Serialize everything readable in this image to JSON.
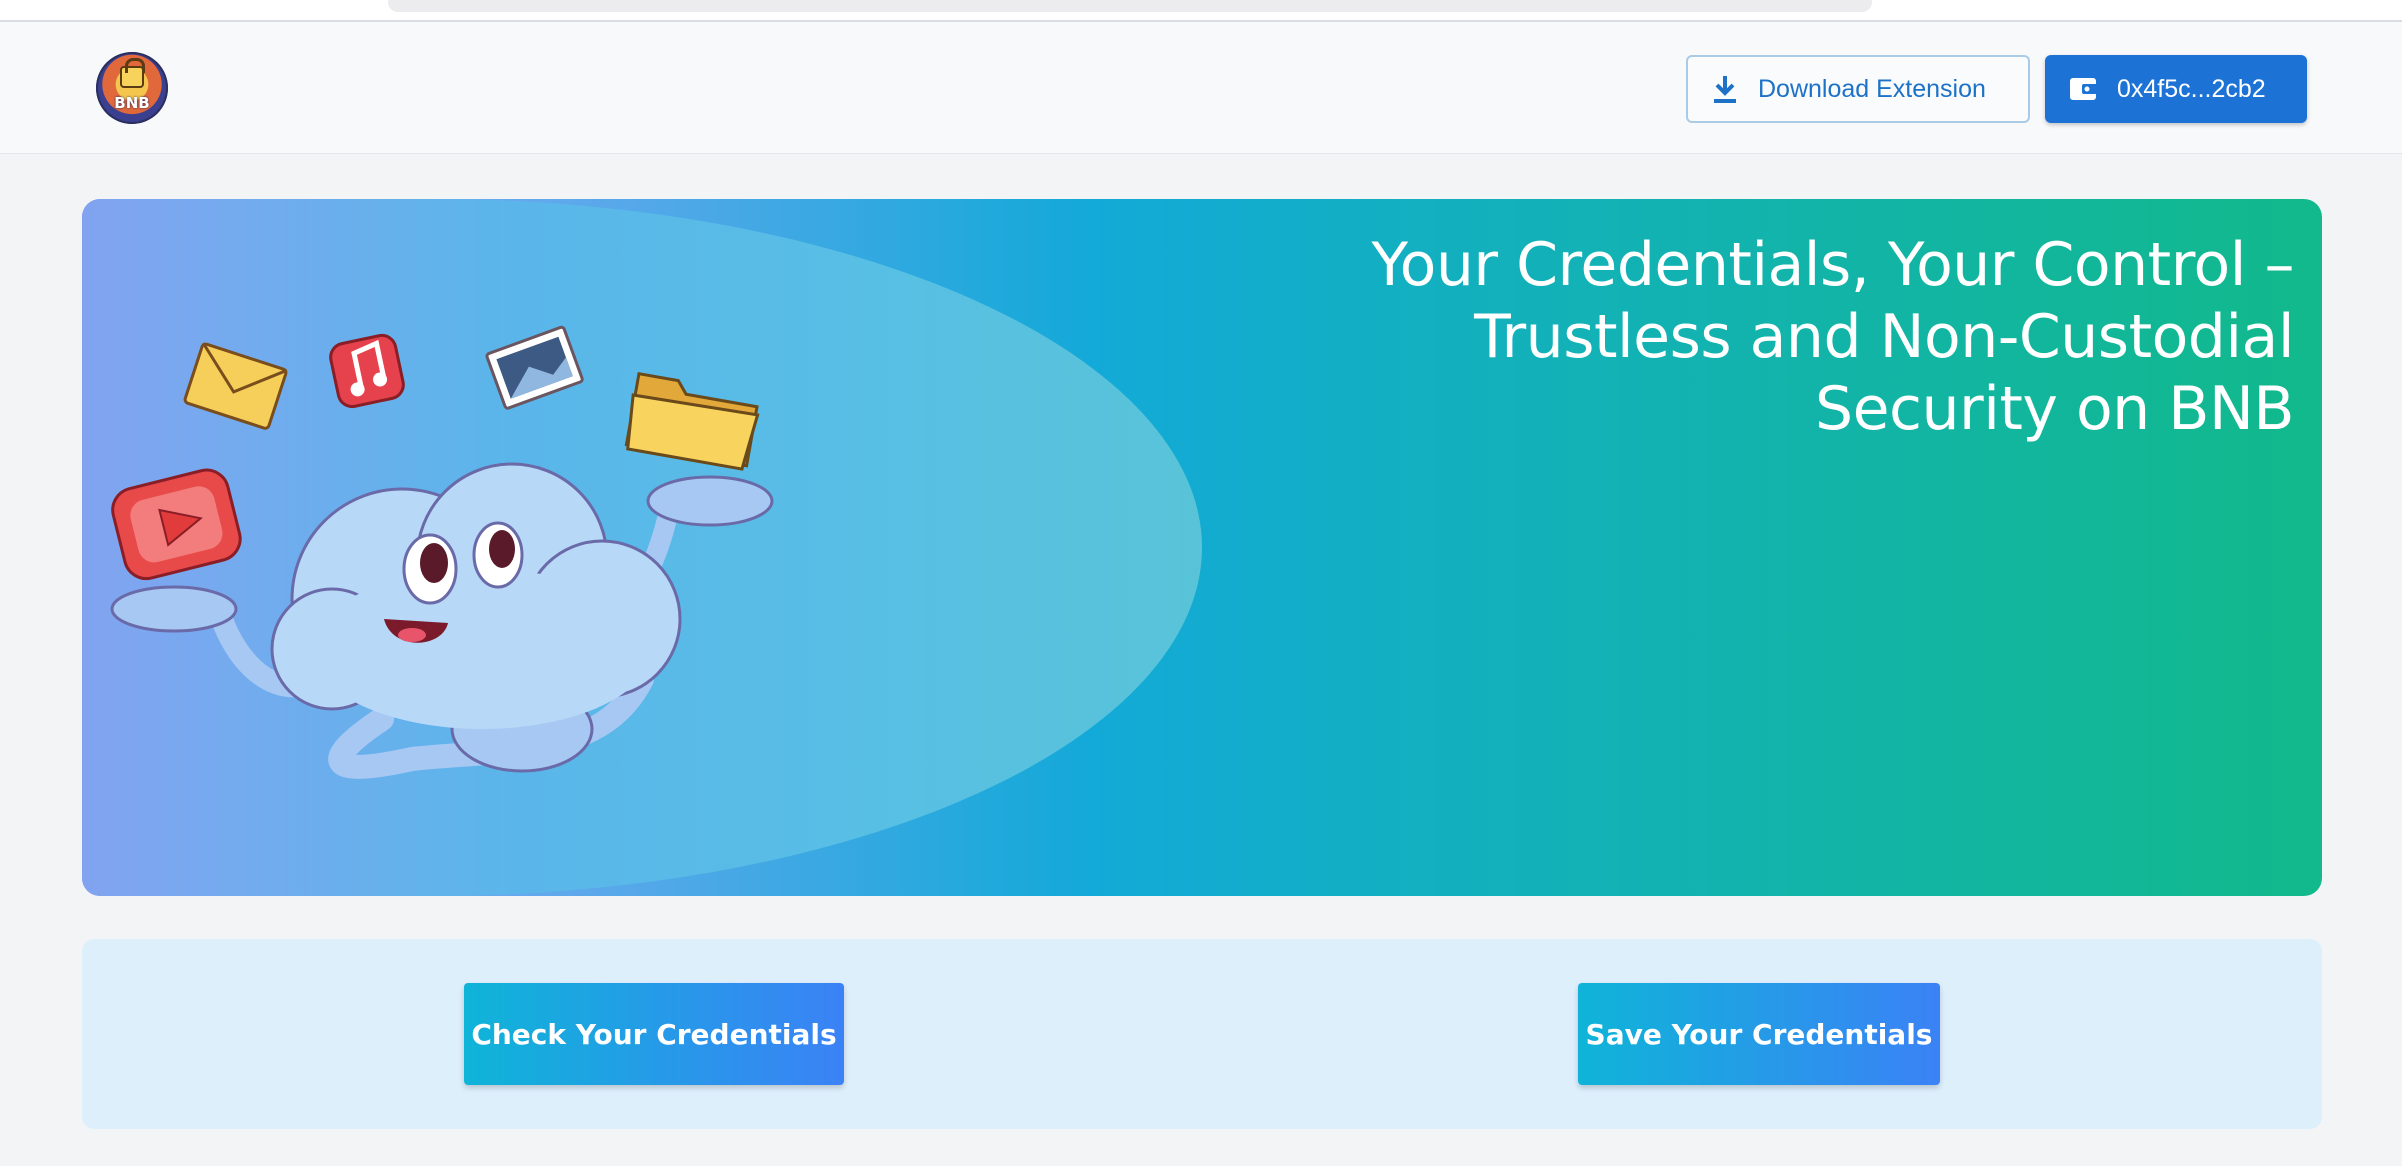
{
  "header": {
    "logo_text": "BNB",
    "download_label": "Download Extension",
    "wallet_label": "0x4f5c...2cb2"
  },
  "hero": {
    "title_line1": "Your Credentials, Your Control –",
    "title_line2": "Trustless and Non-Custodial",
    "title_line3": "Security on BNB"
  },
  "actions": {
    "check_label": "Check Your Credentials",
    "save_label": "Save Your Credentials"
  },
  "icons": {
    "download": "download-icon",
    "wallet": "wallet-icon"
  },
  "colors": {
    "primary": "#1c73d5",
    "hero_start": "#928ff3",
    "hero_end": "#11b98b",
    "action_bg": "#deeffc"
  }
}
